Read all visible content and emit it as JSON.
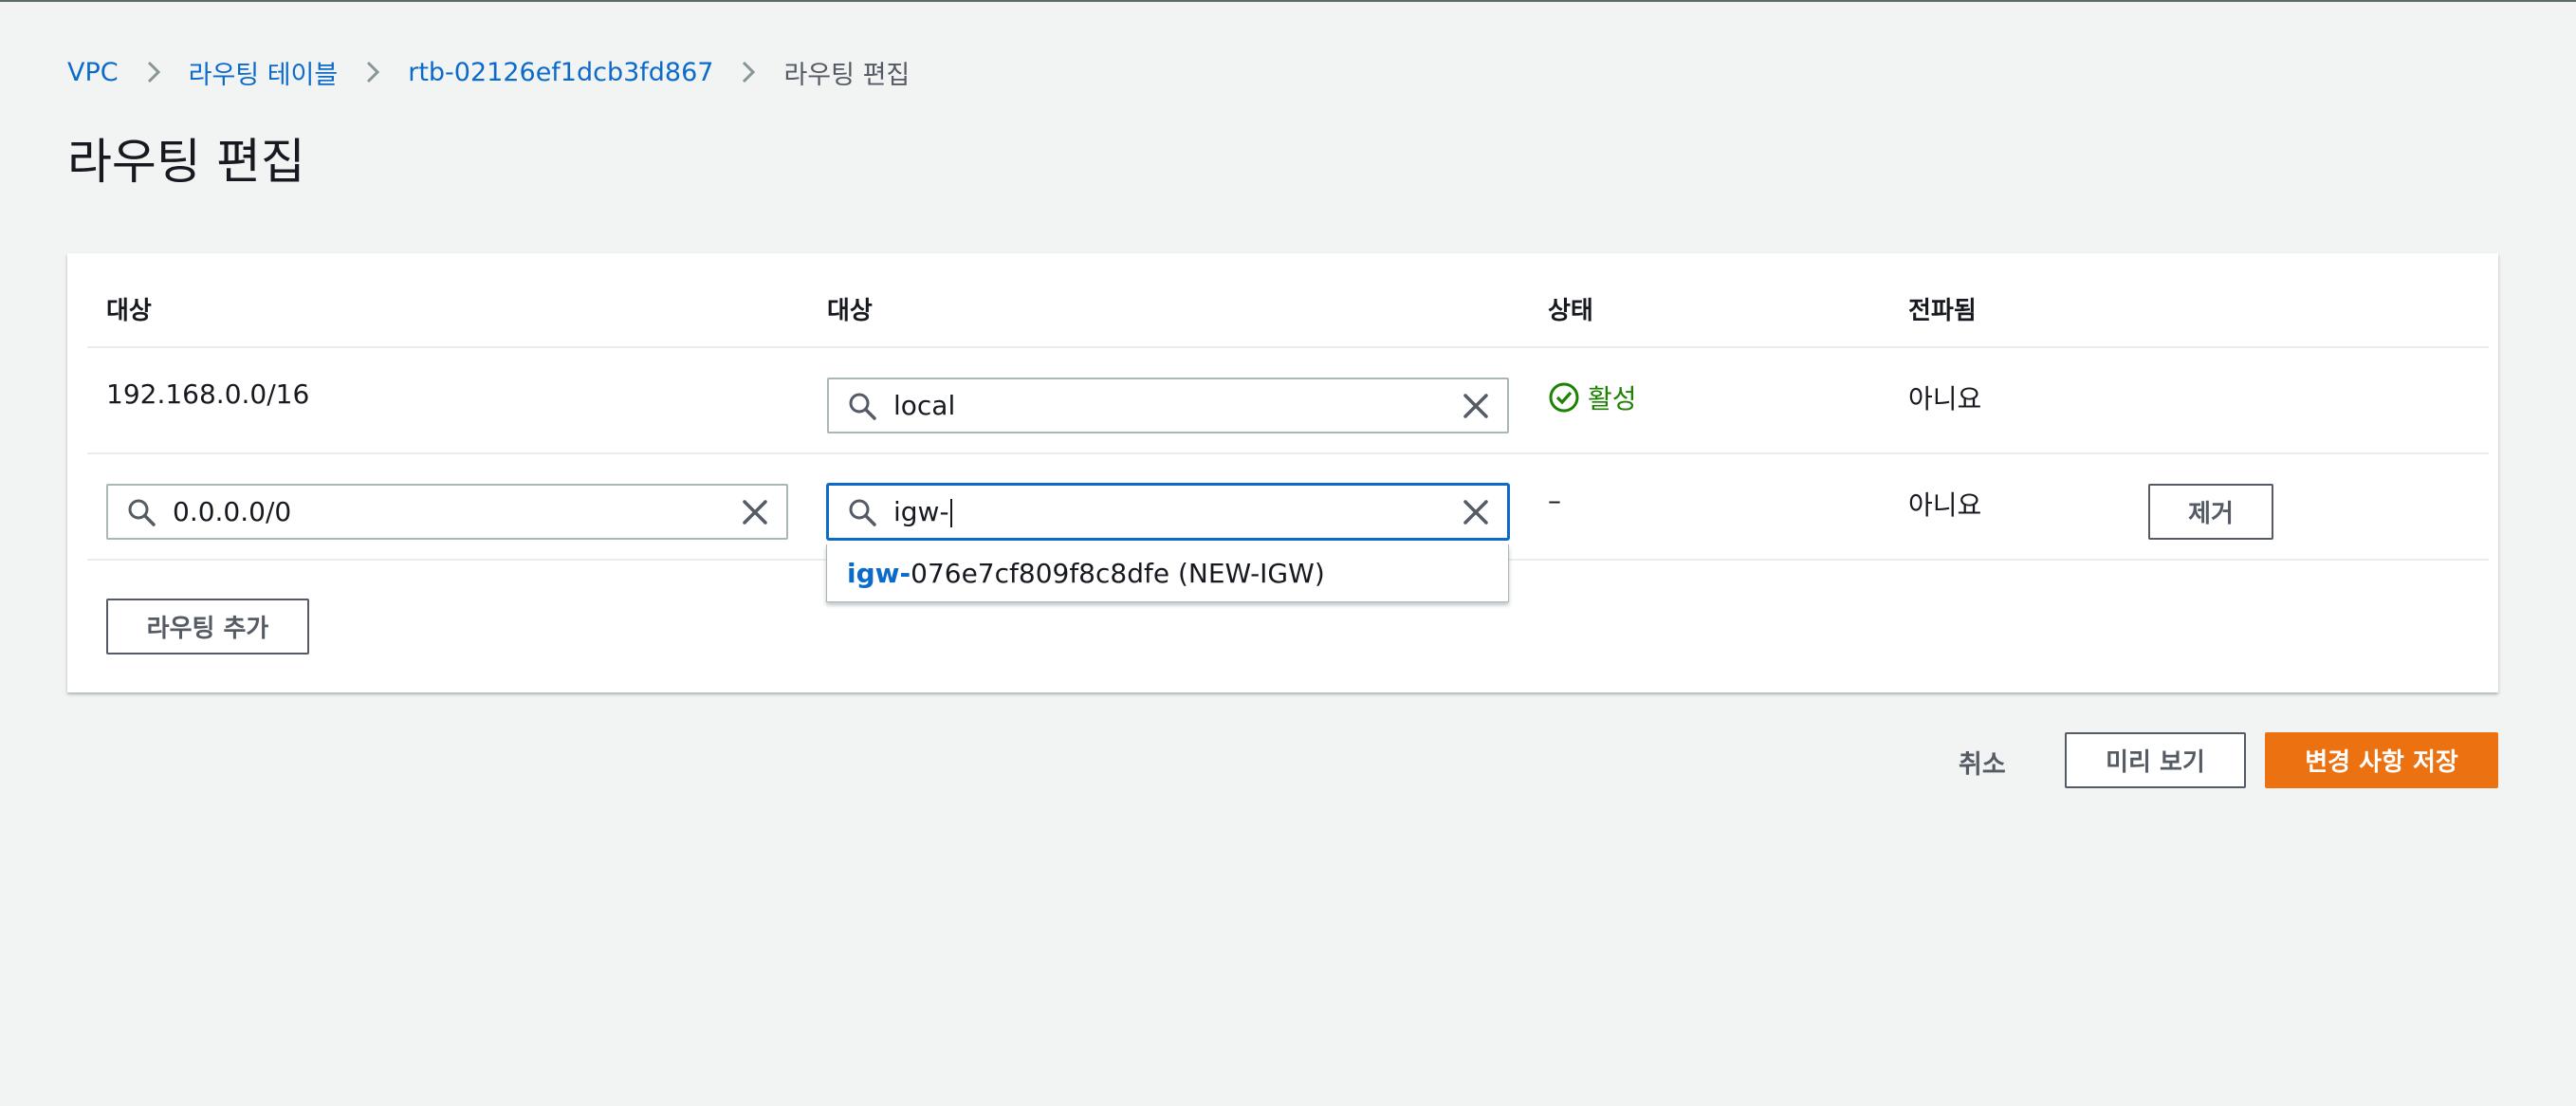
{
  "breadcrumb": {
    "items": [
      "VPC",
      "라우팅 테이블",
      "rtb-02126ef1dcb3fd867"
    ],
    "current": "라우팅 편집"
  },
  "page": {
    "title": "라우팅 편집"
  },
  "table": {
    "headers": [
      "대상",
      "대상",
      "상태",
      "전파됨"
    ],
    "rows": [
      {
        "destination": "192.168.0.0/16",
        "target": "local",
        "status": "활성",
        "propagated": "아니요"
      },
      {
        "destination": "0.0.0.0/0",
        "target": "igw-",
        "status": "–",
        "propagated": "아니요",
        "remove_label": "제거"
      }
    ],
    "dropdown": {
      "match": "igw-",
      "rest": "076e7cf809f8c8dfe (NEW-IGW)"
    },
    "add_route_label": "라우팅 추가"
  },
  "footer": {
    "cancel": "취소",
    "preview": "미리 보기",
    "save": "변경 사항 저장"
  },
  "colors": {
    "link": "#0b6bcb",
    "primary": "#ec7211",
    "success": "#1d8102"
  },
  "icons": [
    "chevron-right-icon",
    "search-icon",
    "clear-icon",
    "success-check-icon"
  ]
}
